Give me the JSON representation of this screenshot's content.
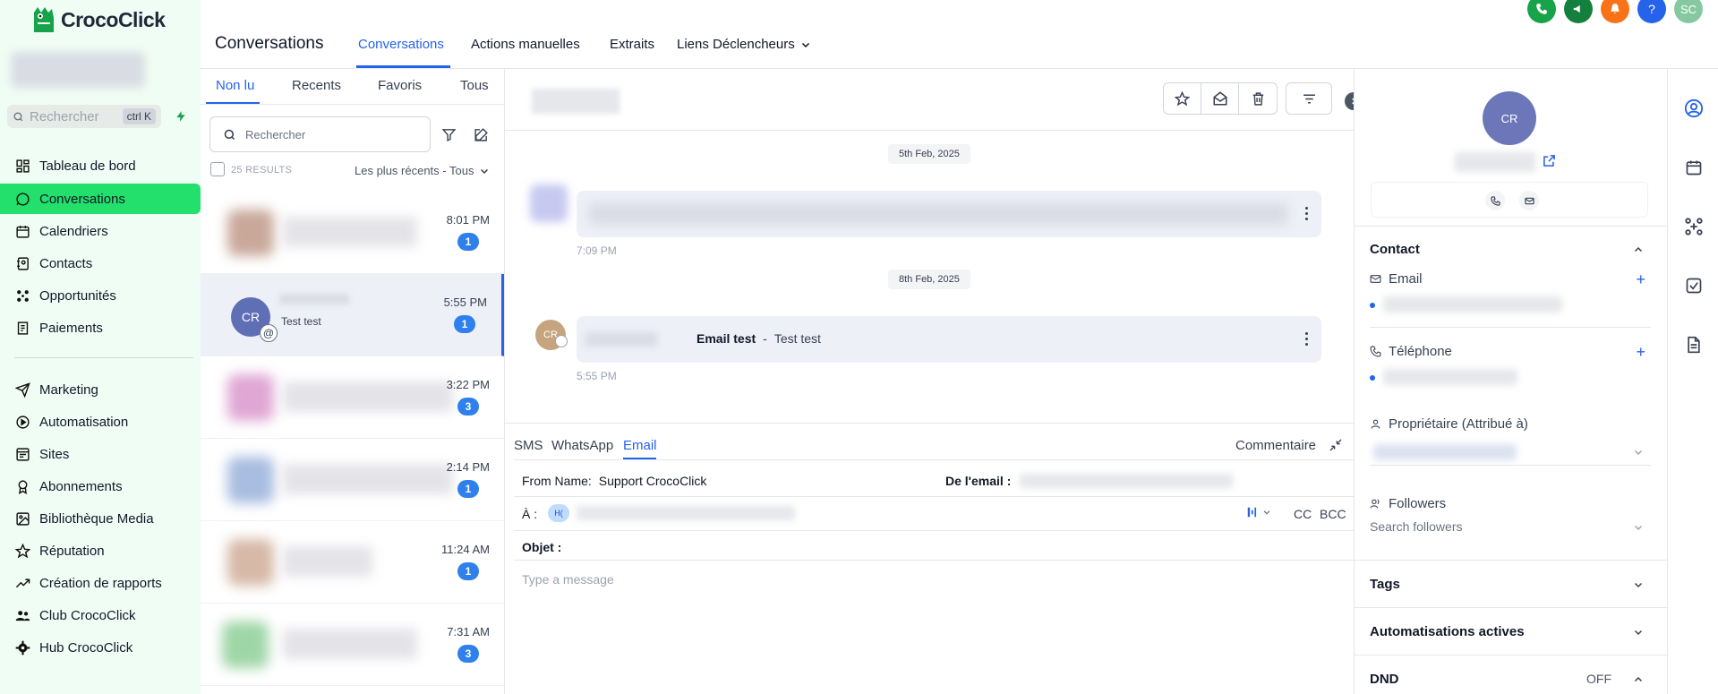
{
  "app": {
    "logo_text": "CrocoClick"
  },
  "sidebar": {
    "search_placeholder": "Rechercher",
    "search_shortcut": "ctrl K",
    "items": [
      {
        "label": "Tableau de bord",
        "icon": "dashboard-icon"
      },
      {
        "label": "Conversations",
        "icon": "chat-bubble-icon",
        "active": true
      },
      {
        "label": "Calendriers",
        "icon": "calendar-icon"
      },
      {
        "label": "Contacts",
        "icon": "contact-book-icon"
      },
      {
        "label": "Opportunités",
        "icon": "pipeline-icon"
      },
      {
        "label": "Paiements",
        "icon": "receipt-icon"
      },
      {
        "label": "Marketing",
        "icon": "send-icon"
      },
      {
        "label": "Automatisation",
        "icon": "automation-icon"
      },
      {
        "label": "Sites",
        "icon": "sites-icon"
      },
      {
        "label": "Abonnements",
        "icon": "badge-icon"
      },
      {
        "label": "Bibliothèque Media",
        "icon": "image-icon"
      },
      {
        "label": "Réputation",
        "icon": "star-icon"
      },
      {
        "label": "Création de rapports",
        "icon": "trend-icon"
      },
      {
        "label": "Club CrocoClick",
        "icon": "users-icon"
      },
      {
        "label": "Hub CrocoClick",
        "icon": "gear-icon"
      }
    ]
  },
  "header": {
    "title": "Conversations",
    "tabs": [
      "Conversations",
      "Actions manuelles",
      "Extraits",
      "Liens Déclencheurs"
    ],
    "user_initials": "SC",
    "help_label": "?"
  },
  "conversations": {
    "filters": [
      "Non lu",
      "Recents",
      "Favoris",
      "Tous"
    ],
    "search_placeholder": "Rechercher",
    "results": "25 RESULTS",
    "sort": "Les plus récents - Tous",
    "rows": [
      {
        "time": "8:01 PM",
        "badge": "1",
        "color": "#c9a89a"
      },
      {
        "time": "5:55 PM",
        "badge": "1",
        "initials": "CR",
        "preview": "Test test",
        "selected": true
      },
      {
        "time": "3:22 PM",
        "badge": "3",
        "color": "#e0a7d4"
      },
      {
        "time": "2:14 PM",
        "badge": "1",
        "color": "#a8bde0"
      },
      {
        "time": "11:24 AM",
        "badge": "1",
        "color": "#d6b9a6"
      },
      {
        "time": "7:31 AM",
        "badge": "3",
        "color": "#9fd6a7"
      }
    ]
  },
  "thread": {
    "date1": "5th Feb, 2025",
    "time1": "7:09 PM",
    "date2": "8th Feb, 2025",
    "msg2_avatar": "CR",
    "msg2_subject": "Email test",
    "msg2_sep": "-",
    "msg2_preview": "Test test",
    "time2": "5:55 PM"
  },
  "composer": {
    "channels": [
      "SMS",
      "WhatsApp",
      "Email"
    ],
    "active_channel": "Email",
    "comment_label": "Commentaire",
    "from_name_label": "From Name:",
    "from_name_value": "Support CrocoClick",
    "from_email_label": "De l'email :",
    "to_label": "À :",
    "to_chip": "H(",
    "cc": "CC",
    "bcc": "BCC",
    "subject_label": "Objet :",
    "message_placeholder": "Type a message"
  },
  "contact": {
    "avatar": "CR",
    "section_contact": "Contact",
    "email_label": "Email",
    "phone_label": "Téléphone",
    "owner_label": "Propriétaire (Attribué à)",
    "followers_label": "Followers",
    "followers_placeholder": "Search followers",
    "tags": "Tags",
    "automations": "Automatisations actives",
    "dnd": "DND",
    "dnd_value": "OFF"
  },
  "colors": {
    "accent": "#2563eb",
    "brand_green": "#22e06b",
    "sidebar_bg": "#f0fdf4",
    "badge": "#2f80ed",
    "avatar": "#5f6fb5"
  }
}
